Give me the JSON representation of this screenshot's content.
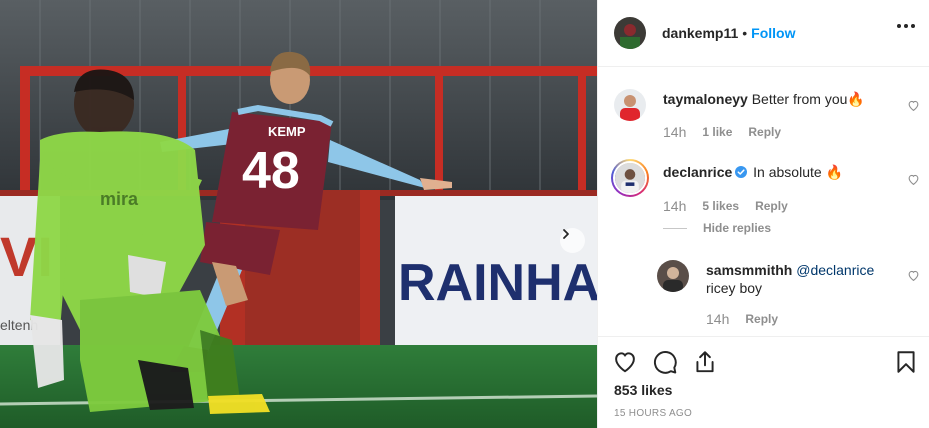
{
  "photo": {
    "jersey_name": "KEMP",
    "jersey_number": "48",
    "shirt_sponsor": "mira",
    "sign_text_1": "RAINHAM'S",
    "sign_text_2": "VI",
    "sign_text_3": "eltenh"
  },
  "post_header": {
    "username": "dankemp11",
    "separator": "•",
    "follow_label": "Follow"
  },
  "comments": [
    {
      "username": "taymaloneyy",
      "text": "Better from you🔥",
      "time": "14h",
      "likes": "1 like",
      "reply_label": "Reply"
    },
    {
      "username": "declanrice",
      "verified": true,
      "text": "In absolute 🔥",
      "time": "14h",
      "likes": "5 likes",
      "reply_label": "Reply",
      "hide_replies_label": "Hide replies",
      "replies": [
        {
          "username": "samsmmithh",
          "mention": "@declanrice",
          "text": "ricey boy",
          "time": "14h",
          "reply_label": "Reply"
        }
      ]
    }
  ],
  "footer": {
    "likes_text": "853 likes",
    "time_ago": "15 HOURS AGO"
  },
  "icons": {
    "like": "heart-icon",
    "comment": "comment-icon",
    "share": "share-icon",
    "save": "bookmark-icon",
    "more": "more-options-icon",
    "next": "chevron-right-icon"
  },
  "colors": {
    "accent": "#0095f6",
    "text": "#262626",
    "muted": "#8e8e8e",
    "mention": "#00376b",
    "flame": "#ff6a00"
  }
}
